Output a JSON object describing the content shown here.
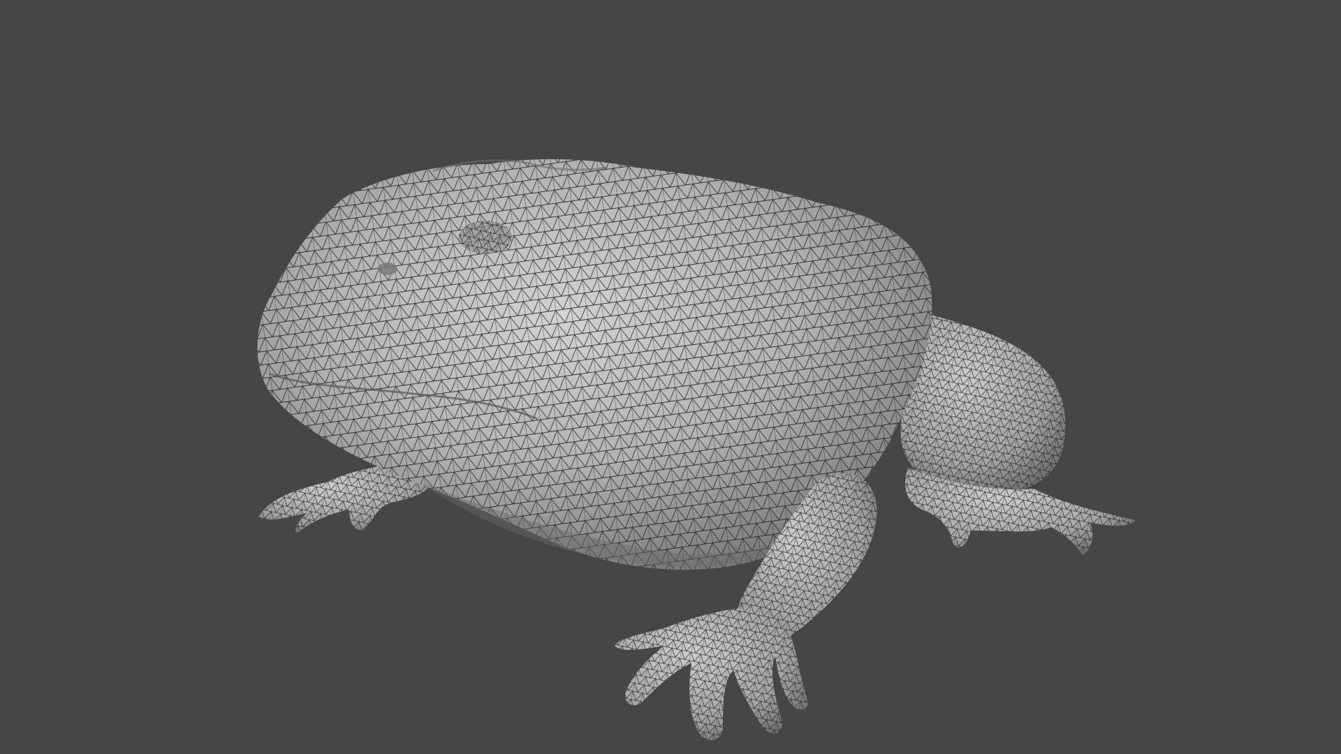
{
  "viewport": {
    "background_color": "#464646",
    "subject": "frog-mesh",
    "display_mode": "wireframe-over-solid",
    "mesh_fill_color": "#a9a9a9",
    "mesh_highlight_color": "#cfcfcf",
    "mesh_shadow_color": "#6a6a6a",
    "wire_color": "#1e1e1e"
  }
}
